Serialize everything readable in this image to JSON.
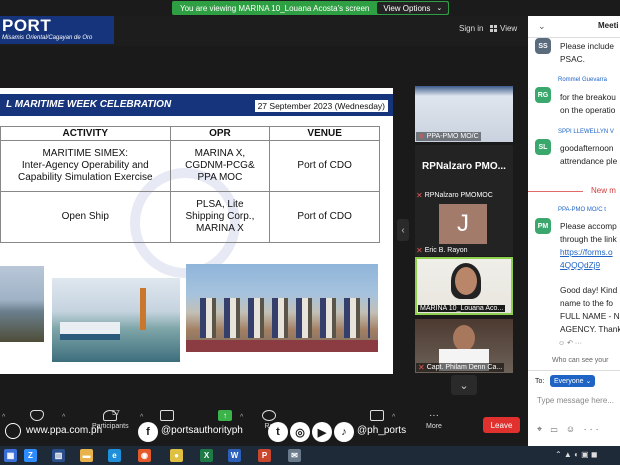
{
  "topbar": {
    "viewing_text": "You are viewing MARINA 10_Louana Acosta's screen",
    "view_options_label": "View Options"
  },
  "header": {
    "logo_title": "PORT",
    "logo_subtitle": "Misamis Oriental/Cagayan de Oro",
    "sign_in": "Sign in",
    "view_label": "View"
  },
  "slide": {
    "title": "L MARITIME WEEK CELEBRATION",
    "date": "27 September 2023 (Wednesday)",
    "table": {
      "headers": [
        "ACTIVITY",
        "OPR",
        "VENUE"
      ],
      "rows": [
        {
          "activity": [
            "MARITIME SIMEX:",
            "Inter-Agency Operability and",
            "Capability Simulation Exercise"
          ],
          "opr": [
            "MARINA X,",
            "CGDNM-PCG&",
            "PPA MOC"
          ],
          "venue": "Port of CDO"
        },
        {
          "activity": [
            "Open Ship"
          ],
          "opr": [
            "PLSA, Lite",
            "Shipping Corp.,",
            "MARINA X"
          ],
          "venue": "Port of CDO"
        }
      ]
    }
  },
  "gallery": {
    "tiles": [
      {
        "label": "PPA-PMO MO/C"
      },
      {
        "name": "RPNalzaro  PMO...",
        "label": "RPNalzaro PMOMOC"
      },
      {
        "initial": "J",
        "label": "Eric B. Rayon"
      },
      {
        "label": "MARINA 10_Louana Aco..."
      },
      {
        "label": "Capt. Philam Denn Ca..."
      }
    ]
  },
  "toolbar": {
    "participants_count": "57",
    "participants_label": "Participants",
    "more_label": "More",
    "leave_label": "Leave",
    "re_label": "Re"
  },
  "social": {
    "website": "www.ppa.com.ph",
    "facebook": "@portsauthorityph",
    "handle": "@ph_ports"
  },
  "chat": {
    "title": "Meeti",
    "messages": [
      {
        "avatar": "SS",
        "avatar_color": "#5a6b7d",
        "sender": "",
        "lines": [
          "Please include",
          "PSAC."
        ]
      },
      {
        "avatar": "RG",
        "avatar_color": "#3aa76d",
        "sender": "Rommel Guevarra",
        "lines": [
          "for the breakou",
          "on the operatio"
        ]
      },
      {
        "avatar": "SL",
        "avatar_color": "#3aa76d",
        "sender": "SPPI LLEWELLYN V",
        "lines": [
          "goodafternoon",
          "attrendance ple"
        ]
      },
      {
        "avatar": "PM",
        "avatar_color": "#3aa76d",
        "sender": "PPA-PMO MO/C t",
        "lines": [
          "Please accomp",
          "through the link",
          "https://forms.o",
          "4QQQdZj9",
          "",
          "Good day! Kind",
          "name to the fo",
          "FULL NAME - N",
          "AGENCY. Thank"
        ]
      }
    ],
    "new_messages": "New m",
    "who_can_see": "Who can see your",
    "to_label": "To:",
    "recipient": "Everyone",
    "input_placeholder": "Type message here..."
  },
  "taskbar": {
    "tray_text": "^ ▲"
  }
}
